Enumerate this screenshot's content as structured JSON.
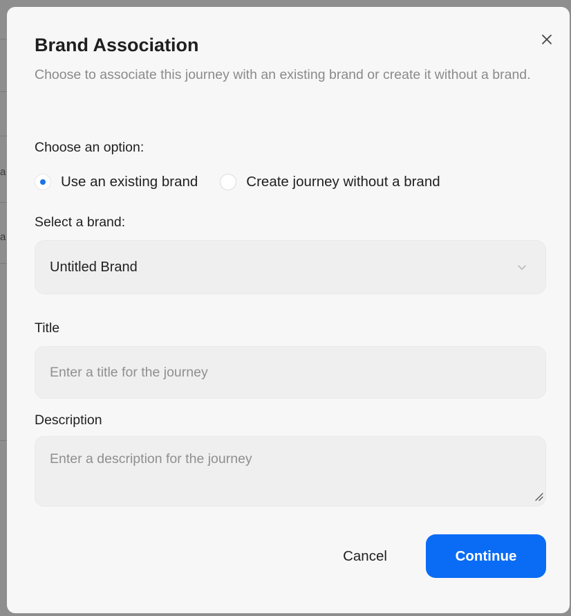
{
  "dialog": {
    "title": "Brand Association",
    "subtitle": "Choose to associate this journey with an existing brand or create it without a brand.",
    "close_icon": "close-icon"
  },
  "option_section": {
    "label": "Choose an option:",
    "options": [
      {
        "label": "Use an existing brand",
        "selected": true
      },
      {
        "label": "Create journey without a brand",
        "selected": false
      }
    ]
  },
  "brand_select": {
    "label": "Select a brand:",
    "selected_value": "Untitled Brand",
    "icon": "chevron-down-icon"
  },
  "title_field": {
    "label": "Title",
    "value": "",
    "placeholder": "Enter a title for the journey"
  },
  "description_field": {
    "label": "Description",
    "value": "",
    "placeholder": "Enter a description for the journey"
  },
  "actions": {
    "cancel_label": "Cancel",
    "continue_label": "Continue"
  },
  "colors": {
    "accent": "#0a6cf5",
    "radio_dot": "#1a73e8",
    "dialog_background": "#f7f7f7",
    "field_background": "#efefef",
    "muted_text": "#8a8a8a"
  }
}
